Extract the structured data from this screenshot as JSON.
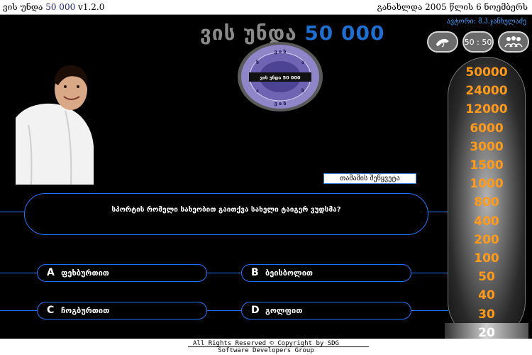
{
  "topbar": {
    "title_prefix": "ვის უნდა",
    "title_amount": "50 000",
    "version": "v1.2.0",
    "date_text": "განახლდა 2005 წლის 6 ნოემბერს"
  },
  "author": "ავტორი: მ.ჰ.ჯანხელაძე",
  "game_title": {
    "words": "ვის უნდა",
    "amount": "50 000"
  },
  "logo": {
    "center_text": "ვის უნდა 50 000"
  },
  "lifelines": [
    {
      "name": "phone",
      "label": ""
    },
    {
      "name": "fifty",
      "label": "50 : 50"
    },
    {
      "name": "audience",
      "label": ""
    }
  ],
  "quit_button": "თამაშის შეწყვეტა",
  "question": "სპორტის რომელი სახეობით გაითქვა სახელი ტაიგერ ვუდსმა?",
  "answers": [
    {
      "letter": "A",
      "text": "ფეხბურთით"
    },
    {
      "letter": "B",
      "text": "ბეისბოლით"
    },
    {
      "letter": "C",
      "text": "ჩოგბურთით"
    },
    {
      "letter": "D",
      "text": "გოლფით"
    }
  ],
  "money_ladder": [
    "50000",
    "24000",
    "12000",
    "6000",
    "3000",
    "1500",
    "1000",
    "800",
    "400",
    "200",
    "100",
    "50",
    "40",
    "30",
    "20"
  ],
  "current_level": "20",
  "footer": {
    "line1": "All Rights Reserved  © Copyright by SDG",
    "line2": "Software Developers Group"
  },
  "colors": {
    "accent": "#1e74ff",
    "money": "#ff9a1a",
    "title_blue": "#1e6fd0"
  }
}
